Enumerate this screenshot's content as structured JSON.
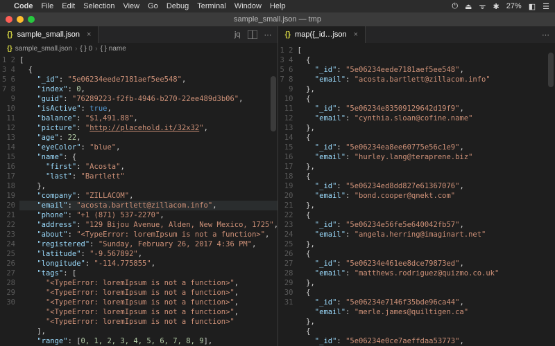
{
  "menubar": {
    "app": "Code",
    "items": [
      "File",
      "Edit",
      "Selection",
      "View",
      "Go",
      "Debug",
      "Terminal",
      "Window",
      "Help"
    ],
    "right": [
      "⏻",
      "⏏",
      "ᯤ",
      "✱",
      "27%",
      "◧",
      "☰"
    ]
  },
  "titlebar": {
    "title": "sample_small.json — tmp"
  },
  "left_pane": {
    "tab_label": "sample_small.json",
    "actions_jq": "jq",
    "breadcrumb": [
      "sample_small.json",
      "{ } 0",
      "{ } name"
    ],
    "lines": [
      {
        "n": 1,
        "t": "[",
        "cls": "p"
      },
      {
        "n": 2,
        "t": "  {",
        "cls": "p"
      },
      {
        "n": 3,
        "t": "    \"_id\": \"5e06234eede7181aef5ee548\",",
        "kv": [
          "_id",
          "5e06234eede7181aef5ee548"
        ]
      },
      {
        "n": 4,
        "t": "    \"index\": 0,",
        "kv_num": [
          "index",
          "0"
        ]
      },
      {
        "n": 5,
        "t": "    \"guid\": \"76289223-f2fb-4946-b270-22ee489d3b06\",",
        "kv": [
          "guid",
          "76289223-f2fb-4946-b270-22ee489d3b06"
        ]
      },
      {
        "n": 6,
        "t": "    \"isActive\": true,",
        "kv_bool": [
          "isActive",
          "true"
        ]
      },
      {
        "n": 7,
        "t": "    \"balance\": \"$1,491.88\",",
        "kv": [
          "balance",
          "$1,491.88"
        ]
      },
      {
        "n": 8,
        "t": "    \"picture\": \"http://placehold.it/32x32\",",
        "kv_url": [
          "picture",
          "http://placehold.it/32x32"
        ]
      },
      {
        "n": 9,
        "t": "    \"age\": 22,",
        "kv_num": [
          "age",
          "22"
        ]
      },
      {
        "n": 10,
        "t": "    \"eyeColor\": \"blue\",",
        "kv": [
          "eyeColor",
          "blue"
        ]
      },
      {
        "n": 11,
        "t": "    \"name\": {",
        "kv_obj": [
          "name"
        ]
      },
      {
        "n": 12,
        "t": "      \"first\": \"Acosta\",",
        "kv": [
          "first",
          "Acosta"
        ]
      },
      {
        "n": 13,
        "t": "      \"last\": \"Bartlett\"",
        "kv": [
          "last",
          "Bartlett"
        ]
      },
      {
        "n": 14,
        "t": "    },",
        "cls": "p"
      },
      {
        "n": 15,
        "t": "    \"company\": \"ZILLACOM\",",
        "kv": [
          "company",
          "ZILLACOM"
        ]
      },
      {
        "n": 16,
        "t": "    \"email\": \"acosta.bartlett@zillacom.info\",",
        "kv": [
          "email",
          "acosta.bartlett@zillacom.info"
        ],
        "cursor": true
      },
      {
        "n": 17,
        "t": "    \"phone\": \"+1 (871) 537-2270\",",
        "kv": [
          "phone",
          "+1 (871) 537-2270"
        ]
      },
      {
        "n": 18,
        "t": "    \"address\": \"129 Bijou Avenue, Alden, New Mexico, 1725\",",
        "kv": [
          "address",
          "129 Bijou Avenue, Alden, New Mexico, 1725"
        ]
      },
      {
        "n": 19,
        "t": "    \"about\": \"<TypeError: loremIpsum is not a function>\",",
        "kv": [
          "about",
          "<TypeError: loremIpsum is not a function>"
        ]
      },
      {
        "n": 20,
        "t": "    \"registered\": \"Sunday, February 26, 2017 4:36 PM\",",
        "kv": [
          "registered",
          "Sunday, February 26, 2017 4:36 PM"
        ]
      },
      {
        "n": 21,
        "t": "    \"latitude\": \"-9.567892\",",
        "kv": [
          "latitude",
          "-9.567892"
        ]
      },
      {
        "n": 22,
        "t": "    \"longitude\": \"-114.775855\",",
        "kv": [
          "longitude",
          "-114.775855"
        ]
      },
      {
        "n": 23,
        "t": "    \"tags\": [",
        "kv_arr": [
          "tags"
        ]
      },
      {
        "n": 24,
        "t": "      \"<TypeError: loremIpsum is not a function>\",",
        "str": "<TypeError: loremIpsum is not a function>"
      },
      {
        "n": 25,
        "t": "      \"<TypeError: loremIpsum is not a function>\",",
        "str": "<TypeError: loremIpsum is not a function>"
      },
      {
        "n": 26,
        "t": "      \"<TypeError: loremIpsum is not a function>\",",
        "str": "<TypeError: loremIpsum is not a function>"
      },
      {
        "n": 27,
        "t": "      \"<TypeError: loremIpsum is not a function>\",",
        "str": "<TypeError: loremIpsum is not a function>"
      },
      {
        "n": 28,
        "t": "      \"<TypeError: loremIpsum is not a function>\"",
        "str": "<TypeError: loremIpsum is not a function>"
      },
      {
        "n": 29,
        "t": "    ],",
        "cls": "p"
      },
      {
        "n": 30,
        "t": "    \"range\": [0, 1, 2, 3, 4, 5, 6, 7, 8, 9],",
        "kv_range": [
          "range",
          "0, 1, 2, 3, 4, 5, 6, 7, 8, 9"
        ]
      }
    ]
  },
  "right_pane": {
    "tab_label": "map({_id…json",
    "lines": [
      {
        "n": 1,
        "t": "[",
        "cls": "p"
      },
      {
        "n": 2,
        "t": "  {",
        "cls": "p"
      },
      {
        "n": 3,
        "t": "    \"_id\": \"5e06234eede7181aef5ee548\",",
        "kv": [
          "_id",
          "5e06234eede7181aef5ee548"
        ]
      },
      {
        "n": 4,
        "t": "    \"email\": \"acosta.bartlett@zillacom.info\"",
        "kv": [
          "email",
          "acosta.bartlett@zillacom.info"
        ]
      },
      {
        "n": 5,
        "t": "  },",
        "cls": "p"
      },
      {
        "n": 6,
        "t": "  {",
        "cls": "p"
      },
      {
        "n": 7,
        "t": "    \"_id\": \"5e06234e83509129642d19f9\",",
        "kv": [
          "_id",
          "5e06234e83509129642d19f9"
        ]
      },
      {
        "n": 8,
        "t": "    \"email\": \"cynthia.sloan@cofine.name\"",
        "kv": [
          "email",
          "cynthia.sloan@cofine.name"
        ]
      },
      {
        "n": 9,
        "t": "  },",
        "cls": "p"
      },
      {
        "n": 10,
        "t": "  {",
        "cls": "p"
      },
      {
        "n": 11,
        "t": "    \"_id\": \"5e06234ea8ee60775e56c1e9\",",
        "kv": [
          "_id",
          "5e06234ea8ee60775e56c1e9"
        ]
      },
      {
        "n": 12,
        "t": "    \"email\": \"hurley.lang@teraprene.biz\"",
        "kv": [
          "email",
          "hurley.lang@teraprene.biz"
        ]
      },
      {
        "n": 13,
        "t": "  },",
        "cls": "p"
      },
      {
        "n": 14,
        "t": "  {",
        "cls": "p"
      },
      {
        "n": 15,
        "t": "    \"_id\": \"5e06234ed8dd827e61367076\",",
        "kv": [
          "_id",
          "5e06234ed8dd827e61367076"
        ]
      },
      {
        "n": 16,
        "t": "    \"email\": \"bond.cooper@qnekt.com\"",
        "kv": [
          "email",
          "bond.cooper@qnekt.com"
        ]
      },
      {
        "n": 17,
        "t": "  },",
        "cls": "p"
      },
      {
        "n": 18,
        "t": "  {",
        "cls": "p"
      },
      {
        "n": 19,
        "t": "    \"_id\": \"5e06234e56fe5e640042fb57\",",
        "kv": [
          "_id",
          "5e06234e56fe5e640042fb57"
        ]
      },
      {
        "n": 20,
        "t": "    \"email\": \"angela.herring@imaginart.net\"",
        "kv": [
          "email",
          "angela.herring@imaginart.net"
        ]
      },
      {
        "n": 21,
        "t": "  },",
        "cls": "p"
      },
      {
        "n": 22,
        "t": "  {",
        "cls": "p"
      },
      {
        "n": 23,
        "t": "    \"_id\": \"5e06234e461ee8dce79873ed\",",
        "kv": [
          "_id",
          "5e06234e461ee8dce79873ed"
        ]
      },
      {
        "n": 24,
        "t": "    \"email\": \"matthews.rodriguez@quizmo.co.uk\"",
        "kv": [
          "email",
          "matthews.rodriguez@quizmo.co.uk"
        ]
      },
      {
        "n": 25,
        "t": "  },",
        "cls": "p"
      },
      {
        "n": 26,
        "t": "  {",
        "cls": "p"
      },
      {
        "n": 27,
        "t": "    \"_id\": \"5e06234e7146f35bde96ca44\",",
        "kv": [
          "_id",
          "5e06234e7146f35bde96ca44"
        ]
      },
      {
        "n": 28,
        "t": "    \"email\": \"merle.james@quiltigen.ca\"",
        "kv": [
          "email",
          "merle.james@quiltigen.ca"
        ]
      },
      {
        "n": 29,
        "t": "  },",
        "cls": "p"
      },
      {
        "n": 30,
        "t": "  {",
        "cls": "p"
      },
      {
        "n": 31,
        "t": "    \"_id\": \"5e06234e0ce7aeffdaa53773\",",
        "kv": [
          "_id",
          "5e06234e0ce7aeffdaa53773"
        ]
      }
    ]
  }
}
